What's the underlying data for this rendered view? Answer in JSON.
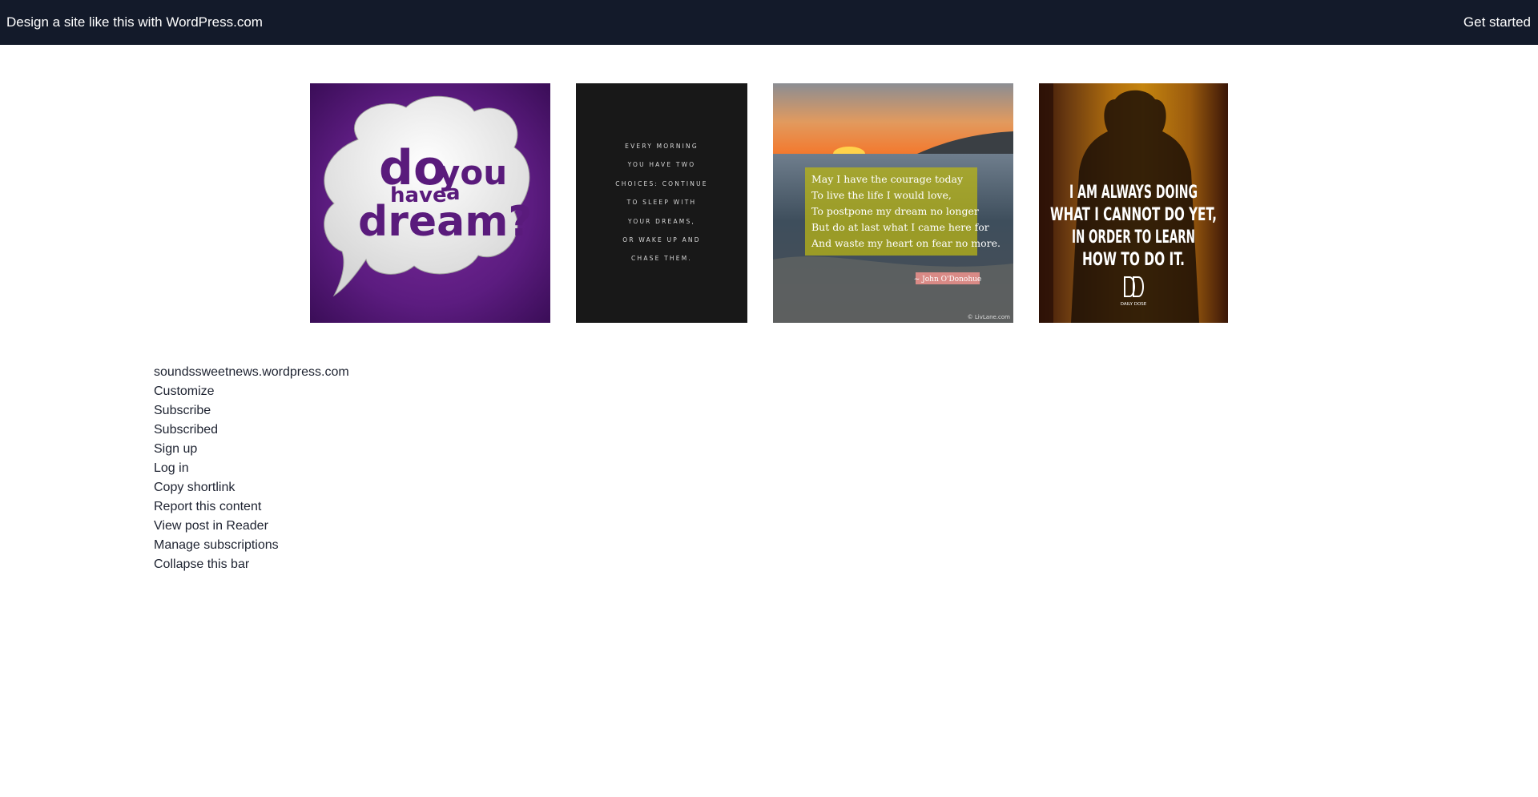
{
  "topbar": {
    "left_link": "Design a site like this with WordPress.com",
    "right_link": "Get started"
  },
  "gallery": {
    "tile1": {
      "line1a": "do",
      "line1b": "you",
      "line2a": "have",
      "line2b": "a",
      "line3": "dream?"
    },
    "tile2": {
      "lines": [
        "EVERY MORNING",
        "YOU HAVE TWO",
        "CHOICES: CONTINUE",
        "TO SLEEP WITH",
        "YOUR DREAMS,",
        "OR WAKE UP AND",
        "CHASE THEM."
      ]
    },
    "tile3": {
      "lines": [
        "May I have the courage today",
        "To live the life I would love,",
        "To postpone my dream no longer",
        "But do at last what I came here for",
        "And waste my heart on fear no more."
      ],
      "attribution": "~ John O'Donohue",
      "watermark": "© LivLane.com"
    },
    "tile4": {
      "lines": [
        "I AM ALWAYS DOING",
        "WHAT I CANNOT DO YET,",
        "IN ORDER TO LEARN",
        "HOW TO DO IT."
      ],
      "logo_caption": "DAILY DOSE"
    }
  },
  "menu": {
    "items": [
      "soundssweetnews.wordpress.com",
      "Customize",
      "Subscribe",
      "Subscribed",
      "Sign up",
      "Log in",
      "Copy shortlink",
      "Report this content",
      "View post in Reader",
      "Manage subscriptions",
      "Collapse this bar"
    ]
  }
}
